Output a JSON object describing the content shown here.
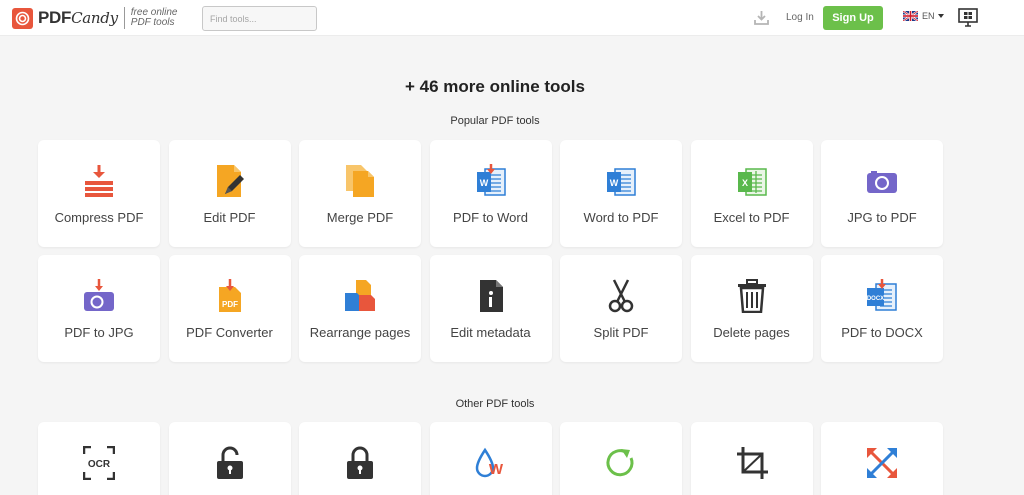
{
  "header": {
    "logo_text": "PDF",
    "logo_text_script": "Candy",
    "tagline_line1": "free online",
    "tagline_line2": "PDF tools",
    "search_placeholder": "Find tools...",
    "login_label": "Log In",
    "signup_label": "Sign Up",
    "language": "EN"
  },
  "main": {
    "title": "+ 46 more online tools",
    "popular_title": "Popular PDF tools",
    "other_title": "Other PDF tools"
  },
  "popular_tools": [
    {
      "label": "Compress PDF",
      "icon": "compress-icon"
    },
    {
      "label": "Edit PDF",
      "icon": "edit-icon"
    },
    {
      "label": "Merge PDF",
      "icon": "merge-icon"
    },
    {
      "label": "PDF to Word",
      "icon": "pdf-to-word-icon"
    },
    {
      "label": "Word to PDF",
      "icon": "word-icon"
    },
    {
      "label": "Excel to PDF",
      "icon": "excel-icon"
    },
    {
      "label": "JPG to PDF",
      "icon": "camera-icon"
    },
    {
      "label": "PDF to JPG",
      "icon": "camera-download-icon"
    },
    {
      "label": "PDF Converter",
      "icon": "pdf-converter-icon"
    },
    {
      "label": "Rearrange pages",
      "icon": "rearrange-icon"
    },
    {
      "label": "Edit metadata",
      "icon": "metadata-icon"
    },
    {
      "label": "Split PDF",
      "icon": "scissors-icon"
    },
    {
      "label": "Delete pages",
      "icon": "trash-icon"
    },
    {
      "label": "PDF to DOCX",
      "icon": "docx-icon"
    }
  ],
  "other_tools_icons": [
    "ocr-icon",
    "unlock-icon",
    "lock-icon",
    "watermark-icon",
    "rotate-icon",
    "crop-icon",
    "resize-icon"
  ],
  "colors": {
    "accent_red": "#e8563c",
    "signup_green": "#6cc04a",
    "word_blue": "#2f7fd6",
    "excel_green": "#59b84c",
    "jpg_purple": "#7466c9",
    "pdf_orange": "#f5a623"
  }
}
